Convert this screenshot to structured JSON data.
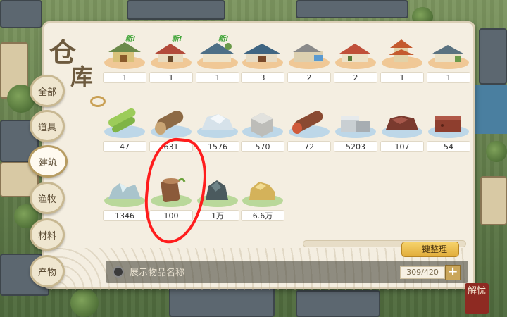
{
  "panel": {
    "title_char_1": "仓",
    "title_char_2": "库"
  },
  "tabs": [
    {
      "label": "全部",
      "active": false
    },
    {
      "label": "道具",
      "active": false
    },
    {
      "label": "建筑",
      "active": true
    },
    {
      "label": "渔牧",
      "active": false
    },
    {
      "label": "材料",
      "active": false
    },
    {
      "label": "产物",
      "active": false
    }
  ],
  "items": [
    {
      "icon": "pavilion-building-icon",
      "count": "1",
      "badge": "新!"
    },
    {
      "icon": "red-house-building-icon",
      "count": "1",
      "badge": "新!"
    },
    {
      "icon": "blue-roof-house-icon",
      "count": "1",
      "badge": "新!"
    },
    {
      "icon": "blue-hall-building-icon",
      "count": "3",
      "badge": ""
    },
    {
      "icon": "courtyard-building-icon",
      "count": "2",
      "badge": ""
    },
    {
      "icon": "red-roof-house-icon",
      "count": "2",
      "badge": ""
    },
    {
      "icon": "tower-building-icon",
      "count": "1",
      "badge": ""
    },
    {
      "icon": "small-house-building-icon",
      "count": "1",
      "badge": ""
    },
    {
      "icon": "bamboo-icon",
      "count": "47",
      "badge": ""
    },
    {
      "icon": "log-icon",
      "count": "631",
      "badge": ""
    },
    {
      "icon": "ice-rock-icon",
      "count": "1576",
      "badge": ""
    },
    {
      "icon": "stone-block-icon",
      "count": "570",
      "badge": ""
    },
    {
      "icon": "red-log-icon",
      "count": "72",
      "badge": ""
    },
    {
      "icon": "stone-bricks-icon",
      "count": "5203",
      "badge": ""
    },
    {
      "icon": "red-ore-icon",
      "count": "107",
      "badge": ""
    },
    {
      "icon": "red-brick-icon",
      "count": "54",
      "badge": ""
    },
    {
      "icon": "crystal-rock-icon",
      "count": "1346",
      "badge": ""
    },
    {
      "icon": "tree-stump-icon",
      "count": "100",
      "badge": ""
    },
    {
      "icon": "dark-stone-icon",
      "count": "1万",
      "badge": ""
    },
    {
      "icon": "gold-ore-icon",
      "count": "6.6万",
      "badge": ""
    }
  ],
  "controls": {
    "sort_label": "一键整理",
    "show_names_label": "展示物品名称",
    "capacity": "309/420",
    "add_label": "+"
  },
  "stamp_text": "解忧"
}
